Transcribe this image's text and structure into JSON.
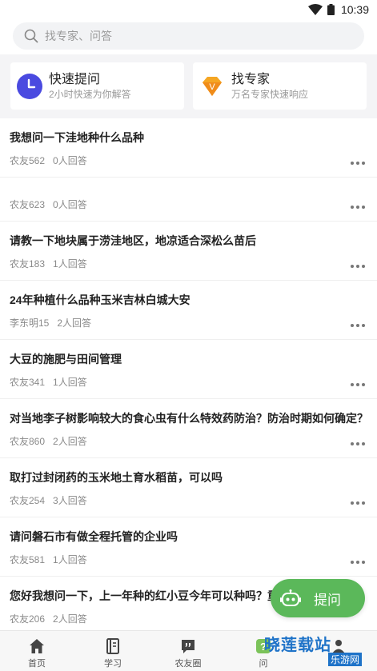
{
  "status": {
    "time": "10:39"
  },
  "search": {
    "placeholder": "找专家、问答"
  },
  "cards": [
    {
      "title": "快速提问",
      "subtitle": "2小时快速为你解答",
      "icon": "clock-icon",
      "color": "#4a4ae0"
    },
    {
      "title": "找专家",
      "subtitle": "万名专家快速响应",
      "icon": "diamond-v-icon",
      "color": "#f5a623"
    }
  ],
  "questions": [
    {
      "title": "我想问一下洼地种什么品种",
      "user": "农友562",
      "answers": "0人回答"
    },
    {
      "title": "",
      "user": "农友623",
      "answers": "0人回答"
    },
    {
      "title": "请教一下地块属于涝洼地区，地凉适合深松么苗后",
      "user": "农友183",
      "answers": "1人回答"
    },
    {
      "title": "24年种植什么品种玉米吉林白城大安",
      "user": "李东明15",
      "answers": "2人回答"
    },
    {
      "title": "大豆的施肥与田间管理",
      "user": "农友341",
      "answers": "1人回答"
    },
    {
      "title": "对当地李子树影响较大的食心虫有什么特效药防治？防治时期如何确定？",
      "user": "农友860",
      "answers": "2人回答"
    },
    {
      "title": "取打过封闭药的玉米地土育水稻苗，可以吗",
      "user": "农友254",
      "answers": "3人回答"
    },
    {
      "title": "请问磐石市有做全程托管的企业吗",
      "user": "农友581",
      "answers": "1人回答"
    },
    {
      "title": "您好我想问一下，上一年种的红小豆今年可以种吗？重茬吗",
      "user": "农友206",
      "answers": "2人回答"
    }
  ],
  "fab": {
    "label": "提问",
    "color": "#5bb85a"
  },
  "tabs": [
    {
      "label": "首页",
      "icon": "home-icon"
    },
    {
      "label": "学习",
      "icon": "book-icon"
    },
    {
      "label": "农友圈",
      "icon": "chat-quote-icon"
    },
    {
      "label": "问",
      "icon": "question-icon"
    },
    {
      "label": "",
      "icon": "profile-icon"
    }
  ],
  "watermark": {
    "text": "晓莲载站",
    "sub": "乐游网"
  }
}
